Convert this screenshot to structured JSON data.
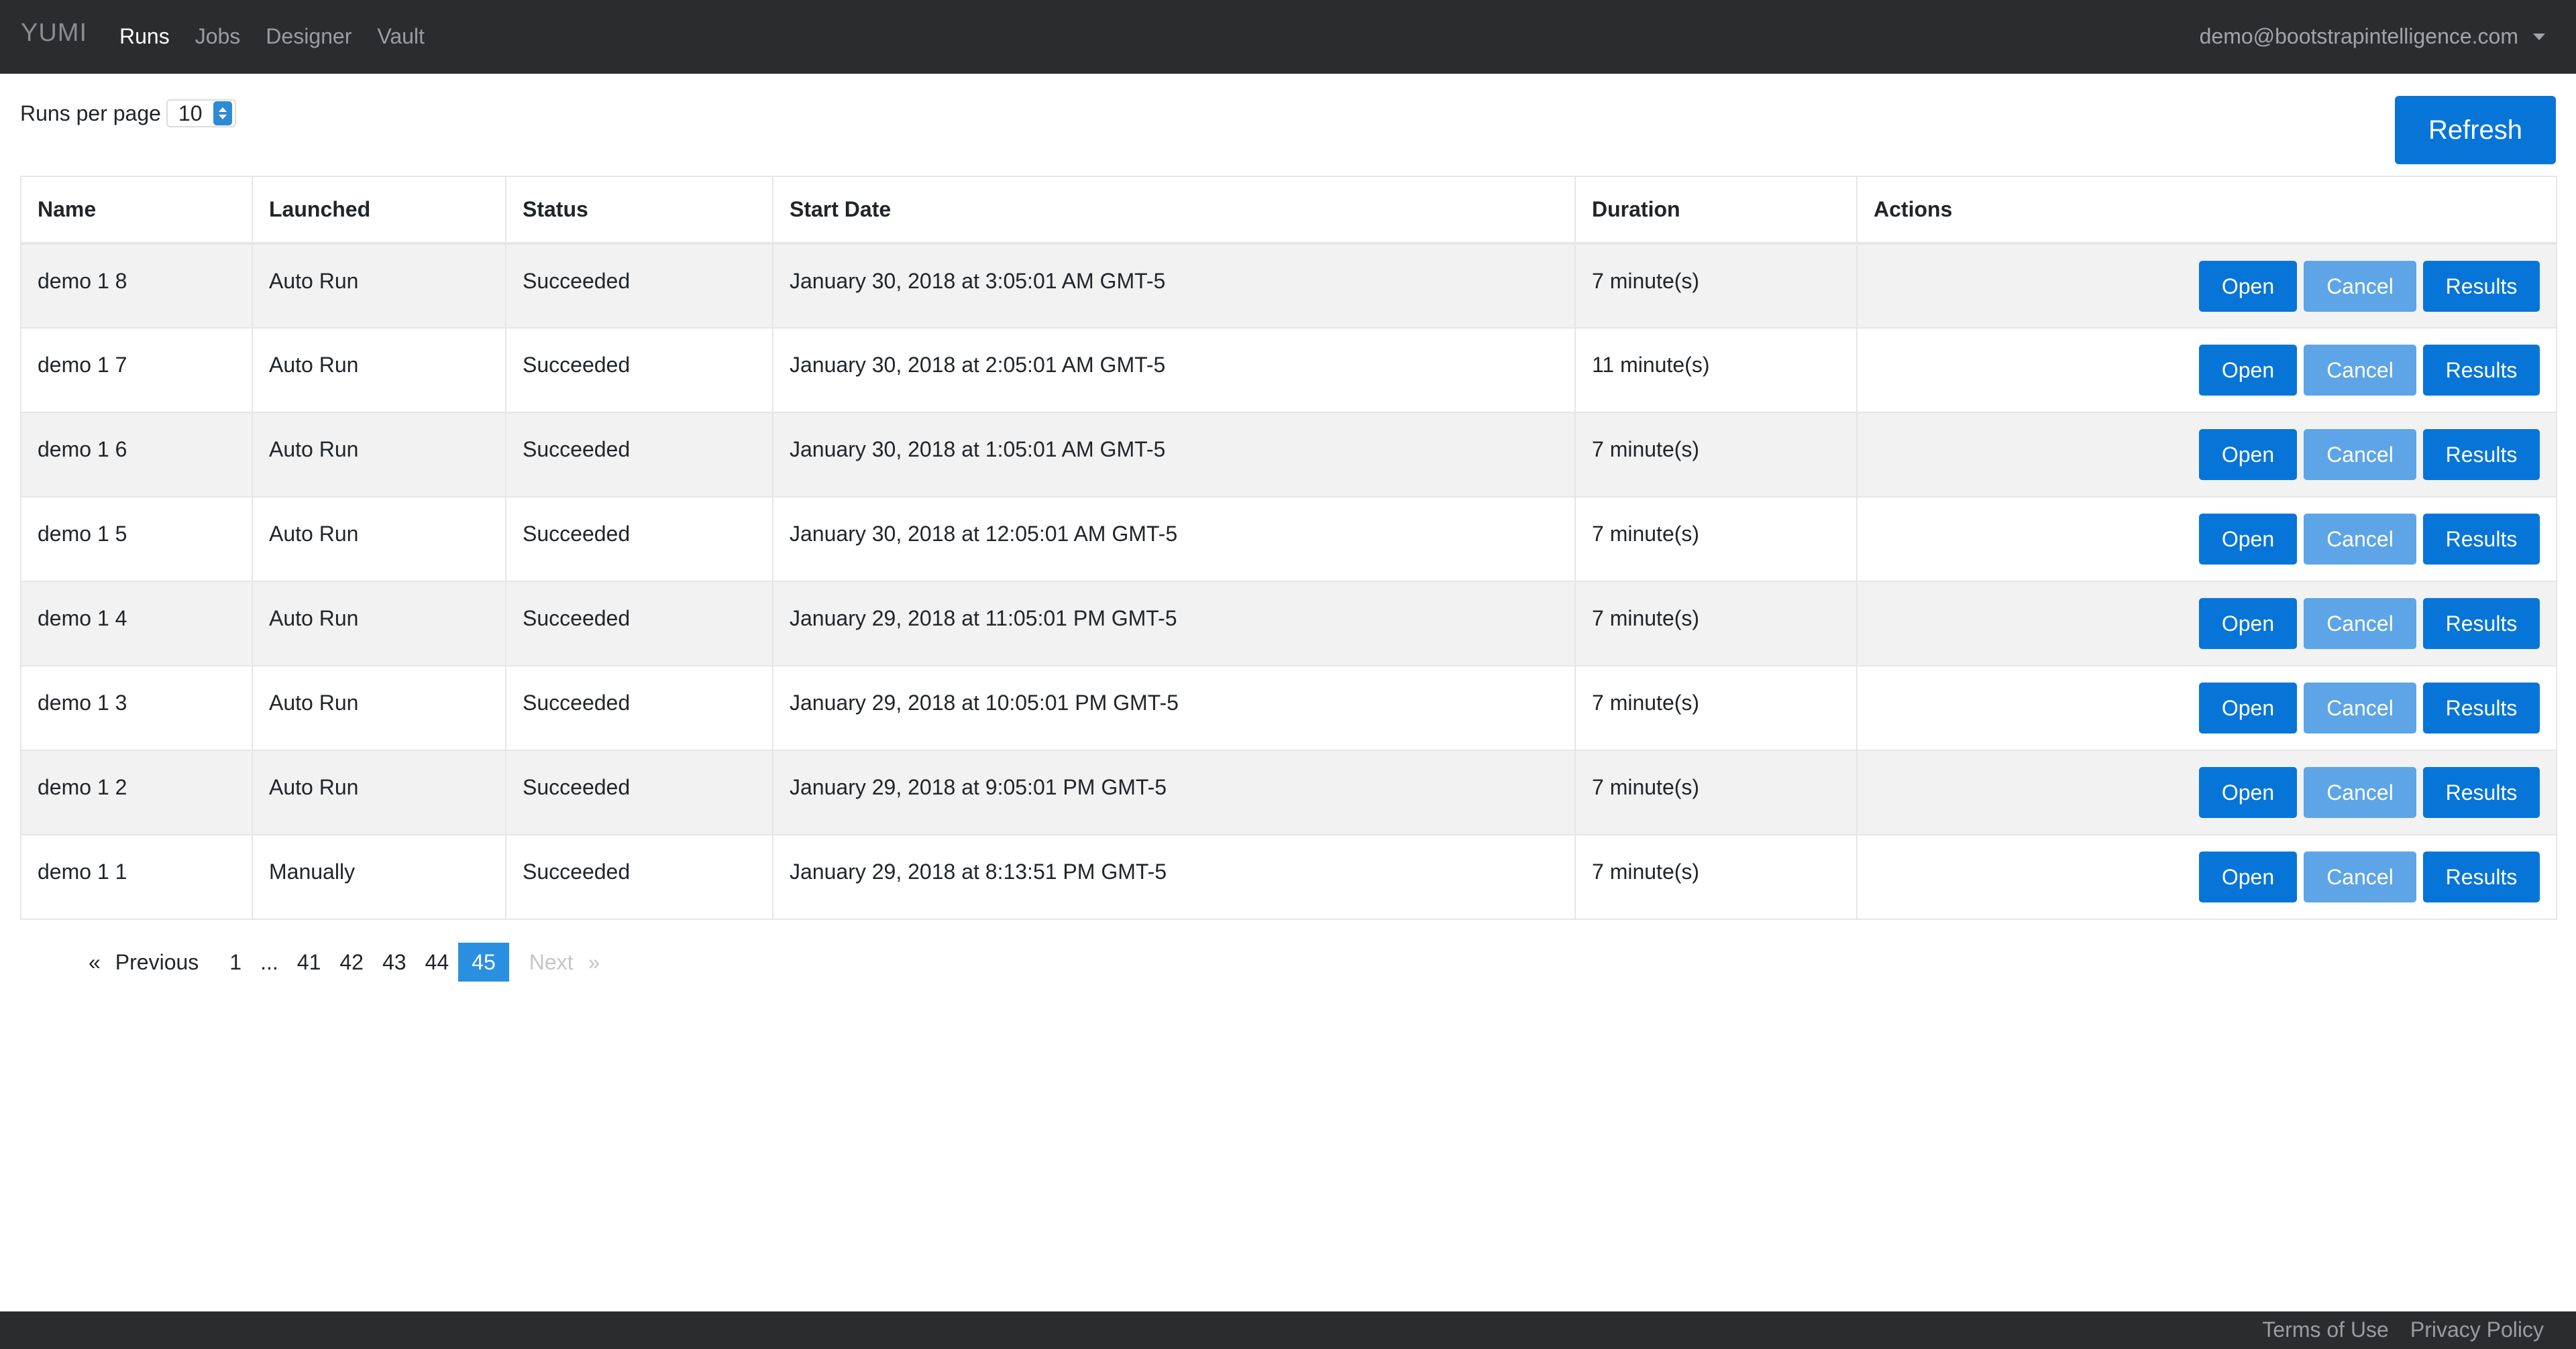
{
  "navbar": {
    "brand": "YUMI",
    "items": [
      {
        "label": "Runs",
        "active": true
      },
      {
        "label": "Jobs",
        "active": false
      },
      {
        "label": "Designer",
        "active": false
      },
      {
        "label": "Vault",
        "active": false
      }
    ],
    "user_email": "demo@bootstrapintelligence.com"
  },
  "toolbar": {
    "per_page_label": "Runs per page",
    "per_page_value": "10",
    "refresh_label": "Refresh"
  },
  "table": {
    "headers": [
      "Name",
      "Launched",
      "Status",
      "Start Date",
      "Duration",
      "Actions"
    ],
    "action_labels": {
      "open": "Open",
      "cancel": "Cancel",
      "results": "Results"
    },
    "rows": [
      {
        "name": "demo 1 8",
        "launched": "Auto Run",
        "status": "Succeeded",
        "start_date": "January 30, 2018 at 3:05:01 AM GMT-5",
        "duration": "7 minute(s)"
      },
      {
        "name": "demo 1 7",
        "launched": "Auto Run",
        "status": "Succeeded",
        "start_date": "January 30, 2018 at 2:05:01 AM GMT-5",
        "duration": "11 minute(s)"
      },
      {
        "name": "demo 1 6",
        "launched": "Auto Run",
        "status": "Succeeded",
        "start_date": "January 30, 2018 at 1:05:01 AM GMT-5",
        "duration": "7 minute(s)"
      },
      {
        "name": "demo 1 5",
        "launched": "Auto Run",
        "status": "Succeeded",
        "start_date": "January 30, 2018 at 12:05:01 AM GMT-5",
        "duration": "7 minute(s)"
      },
      {
        "name": "demo 1 4",
        "launched": "Auto Run",
        "status": "Succeeded",
        "start_date": "January 29, 2018 at 11:05:01 PM GMT-5",
        "duration": "7 minute(s)"
      },
      {
        "name": "demo 1 3",
        "launched": "Auto Run",
        "status": "Succeeded",
        "start_date": "January 29, 2018 at 10:05:01 PM GMT-5",
        "duration": "7 minute(s)"
      },
      {
        "name": "demo 1 2",
        "launched": "Auto Run",
        "status": "Succeeded",
        "start_date": "January 29, 2018 at 9:05:01 PM GMT-5",
        "duration": "7 minute(s)"
      },
      {
        "name": "demo 1 1",
        "launched": "Manually",
        "status": "Succeeded",
        "start_date": "January 29, 2018 at 8:13:51 PM GMT-5",
        "duration": "7 minute(s)"
      }
    ]
  },
  "pagination": {
    "prev_arrow": "«",
    "prev_label": "Previous",
    "pages": [
      "1",
      "...",
      "41",
      "42",
      "43",
      "44",
      "45"
    ],
    "active_page": "45",
    "next_label": "Next",
    "next_arrow": "»"
  },
  "footer": {
    "terms_label": "Terms of Use",
    "privacy_label": "Privacy Policy"
  },
  "colors": {
    "navbar_bg": "#2b2c2e",
    "primary_button": "#0775d8",
    "cancel_button": "#5da5e6",
    "active_page": "#2a8fe0"
  },
  "icons": {
    "user_menu": "caret-down-icon",
    "per_page_select": "select-arrows-icon",
    "previous": "double-left-arrow-icon",
    "next": "double-right-arrow-icon"
  }
}
